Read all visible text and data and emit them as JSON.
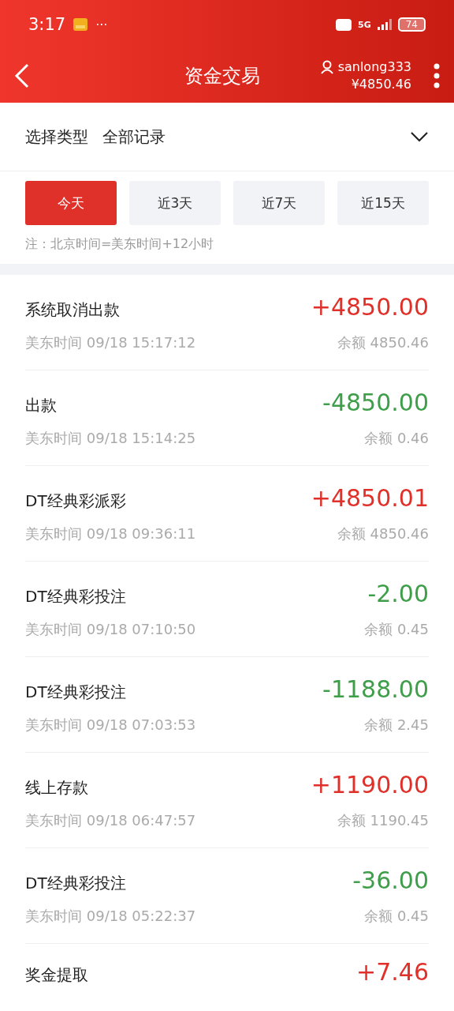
{
  "status_bar": {
    "time": "3:17",
    "more": "···",
    "network": "5G",
    "battery": "74"
  },
  "header": {
    "title": "资金交易",
    "username": "sanlong333",
    "balance": "¥4850.46"
  },
  "filter": {
    "label": "选择类型",
    "value": "全部记录"
  },
  "tabs": [
    {
      "label": "今天",
      "selected": true
    },
    {
      "label": "近3天",
      "selected": false
    },
    {
      "label": "近7天",
      "selected": false
    },
    {
      "label": "近15天",
      "selected": false
    }
  ],
  "note": "注：北京时间=美东时间+12小时",
  "records": [
    {
      "title": "系统取消出款",
      "time": "美东时间 09/18 15:17:12",
      "amount": "+4850.00",
      "color": "#e0302a",
      "balance": "余额 4850.46"
    },
    {
      "title": "出款",
      "time": "美东时间 09/18 15:14:25",
      "amount": "-4850.00",
      "color": "#3f9e4a",
      "balance": "余额 0.46"
    },
    {
      "title": "DT经典彩派彩",
      "time": "美东时间 09/18 09:36:11",
      "amount": "+4850.01",
      "color": "#e0302a",
      "balance": "余额 4850.46"
    },
    {
      "title": "DT经典彩投注",
      "time": "美东时间 09/18 07:10:50",
      "amount": "-2.00",
      "color": "#3f9e4a",
      "balance": "余额 0.45"
    },
    {
      "title": "DT经典彩投注",
      "time": "美东时间 09/18 07:03:53",
      "amount": "-1188.00",
      "color": "#3f9e4a",
      "balance": "余额 2.45"
    },
    {
      "title": "线上存款",
      "time": "美东时间 09/18 06:47:57",
      "amount": "+1190.00",
      "color": "#e0302a",
      "balance": "余额 1190.45"
    },
    {
      "title": "DT经典彩投注",
      "time": "美东时间 09/18 05:22:37",
      "amount": "-36.00",
      "color": "#3f9e4a",
      "balance": "余额 0.45"
    },
    {
      "title": "奖金提取",
      "amount": "+7.46",
      "color": "#e0302a"
    }
  ]
}
